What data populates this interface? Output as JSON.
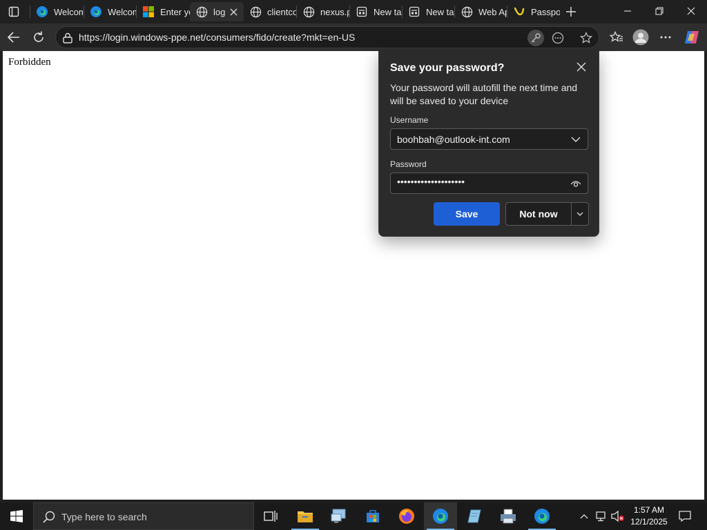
{
  "browser": {
    "tabs": [
      {
        "label": "Welcome",
        "icon": "edge-icon",
        "active": false
      },
      {
        "label": "Welcome",
        "icon": "edge-icon",
        "active": false
      },
      {
        "label": "Enter your",
        "icon": "microsoft-logo-icon",
        "active": false
      },
      {
        "label": "log",
        "icon": "globe-icon",
        "active": true
      },
      {
        "label": "clientconfig",
        "icon": "globe-icon",
        "active": false
      },
      {
        "label": "nexus.pass",
        "icon": "globe-icon",
        "active": false
      },
      {
        "label": "New tab",
        "icon": "newtab-icon",
        "active": false
      },
      {
        "label": "New tab",
        "icon": "newtab-icon",
        "active": false
      },
      {
        "label": "Web App",
        "icon": "globe-icon",
        "active": false
      },
      {
        "label": "Passport",
        "icon": "passport-icon",
        "active": false
      }
    ],
    "url": "https://login.windows-ppe.net/consumers/fido/create?mkt=en-US"
  },
  "page": {
    "body_text": "Forbidden"
  },
  "password_popup": {
    "title": "Save your password?",
    "description": "Your password will autofill the next time and will be saved to your device",
    "username_label": "Username",
    "username_value": "boohbah@outlook-int.com",
    "password_label": "Password",
    "password_value": "••••••••••••••••••••",
    "save_label": "Save",
    "not_now_label": "Not now"
  },
  "taskbar": {
    "search_placeholder": "Type here to search",
    "time": "1:57 AM",
    "date": "12/1/2025"
  },
  "colors": {
    "accent": "#1f5fd6",
    "popup_bg": "#2b2b2b",
    "chrome_bg": "#202020"
  }
}
